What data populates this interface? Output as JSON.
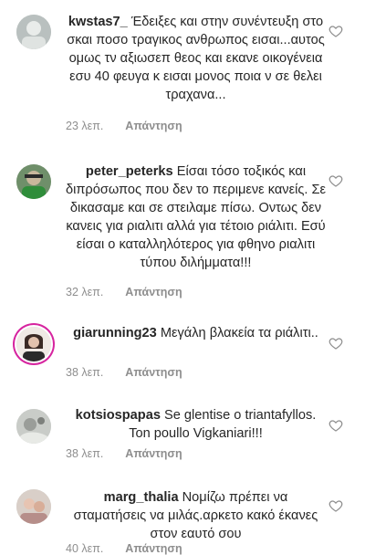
{
  "comments": [
    {
      "username": "kwstas7_",
      "text": "Έδειξες και στην συνέντευξη στο σκαι ποσο τραγικος ανθρωπος εισαι...αυτος ομως τν αξιωσεπ θεος και εκανε οικογένεια εσυ 40 φευγα κ εισαι μονος ποια ν σε θελει τραχανα...",
      "time": "23 λεπ.",
      "reply": "Απάντηση"
    },
    {
      "username": "peter_peterks",
      "text": "Είσαι τόσο τοξικός και διπρόσωπος που δεν το περιμενε κανείς. Σε δικασαμε και σε στειλαμε πίσω. Οντως δεν κανεις για ριαλιτι αλλά για τέτοιο ριάλιτι. Εσύ είσαι ο καταλληλότερος για φθηνο ριαλιτι τύπου διλήμματα!!!",
      "time": "32 λεπ.",
      "reply": "Απάντηση"
    },
    {
      "username": "giarunning23",
      "text": "Μεγάλη βλακεία τα ριάλιτι..",
      "time": "38 λεπ.",
      "reply": "Απάντηση"
    },
    {
      "username": "kotsiospapas",
      "text": "Se glentise o triantafyllos. Ton poullo Vigkaniari!!!",
      "time": "38 λεπ.",
      "reply": "Απάντηση"
    },
    {
      "username": "marg_thalia",
      "text": "Νομίζω πρέπει να σταματήσεις να μιλάς.αρκετο κακό έκανες στον εαυτό σου",
      "time": "40 λεπ.",
      "reply": "Απάντηση"
    }
  ]
}
